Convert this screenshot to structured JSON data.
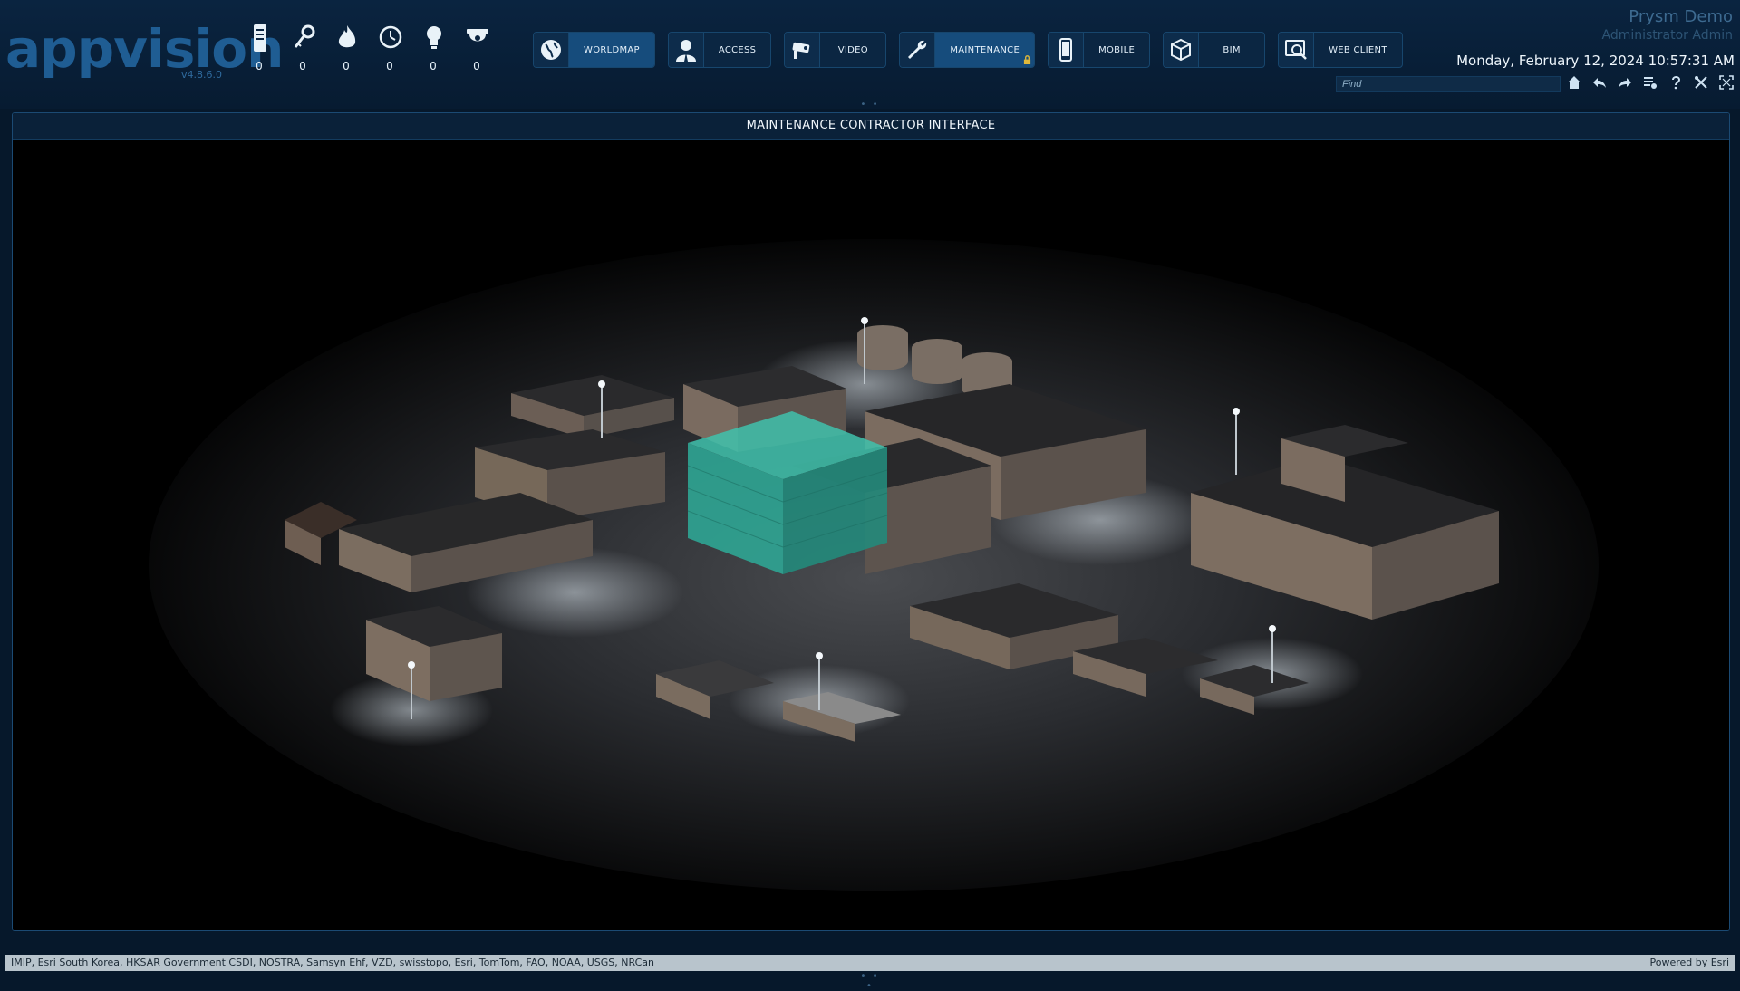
{
  "header": {
    "logo_text": "appvision",
    "version": "v4.8.6.0",
    "company": "Prysm Demo",
    "user": "Administrator Admin",
    "datetime": "Monday, February 12, 2024 10:57:31 AM",
    "find_placeholder": "Find"
  },
  "counters": [
    {
      "icon": "server-icon",
      "value": "0"
    },
    {
      "icon": "key-icon",
      "value": "0"
    },
    {
      "icon": "fire-icon",
      "value": "0"
    },
    {
      "icon": "clock-icon",
      "value": "0"
    },
    {
      "icon": "lightbulb-icon",
      "value": "0"
    },
    {
      "icon": "dome-camera-icon",
      "value": "0"
    }
  ],
  "modules": [
    {
      "label": "WORLDMAP",
      "icon": "globe-icon",
      "active": true
    },
    {
      "label": "ACCESS",
      "icon": "person-icon",
      "active": false
    },
    {
      "label": "VIDEO",
      "icon": "camera-icon",
      "active": false
    },
    {
      "label": "MAINTENANCE",
      "icon": "wrench-icon",
      "active": true,
      "locked": true
    },
    {
      "label": "MOBILE",
      "icon": "phone-icon",
      "active": false
    },
    {
      "label": "BIM",
      "icon": "cube-icon",
      "active": false
    },
    {
      "label": "WEB CLIENT",
      "icon": "web-search-icon",
      "active": false
    }
  ],
  "tools": [
    "home-icon",
    "undo-icon",
    "redo-icon",
    "settings-list-icon",
    "help-icon",
    "tools-icon",
    "fullscreen-icon"
  ],
  "panel": {
    "title": "MAINTENANCE CONTRACTOR INTERFACE"
  },
  "footer": {
    "zoom_info": "",
    "attribution": "IMIP, Esri South Korea, HKSAR Government CSDI, NOSTRA, Samsyn Ehf, VZD, swisstopo, Esri, TomTom, FAO, NOAA, USGS, NRCan",
    "powered_by": "Powered by Esri"
  },
  "colors": {
    "background": "#06182b",
    "accent": "#164c7c",
    "highlight_building": "#2fb3a0"
  }
}
